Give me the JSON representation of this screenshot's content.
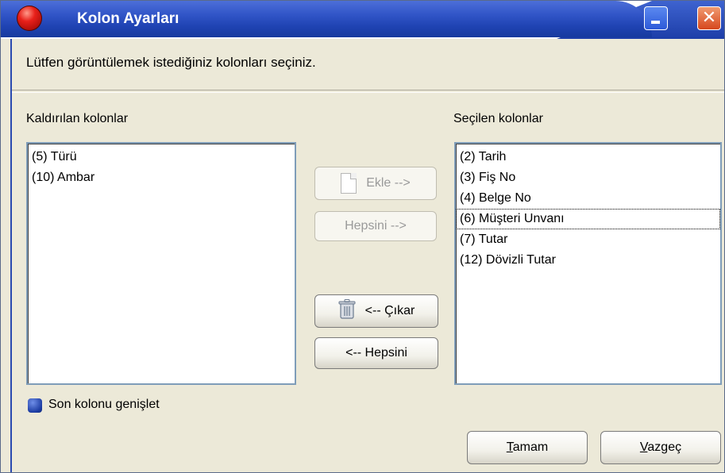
{
  "window": {
    "title": "Kolon Ayarları"
  },
  "instruction": "Lütfen görüntülemek istediğiniz kolonları seçiniz.",
  "left_panel": {
    "label": "Kaldırılan kolonlar",
    "items": [
      "(5) Türü",
      "(10) Ambar"
    ]
  },
  "right_panel": {
    "label": "Seçilen kolonlar",
    "items": [
      "(2) Tarih",
      "(3) Fiş No",
      "(4) Belge No",
      "(6) Müşteri Unvanı",
      "(7) Tutar",
      "(12) Dövizli Tutar"
    ],
    "focused_item": "(6) Müşteri Unvanı"
  },
  "buttons": {
    "add": "Ekle -->",
    "add_all": "Hepsini -->",
    "remove": "<-- Çıkar",
    "remove_all": "<-- Hepsini",
    "ok_first": "T",
    "ok_rest": "amam",
    "cancel_first": "V",
    "cancel_rest": "azgeç"
  },
  "expand_last_column": {
    "label": "Son kolonu genişlet"
  },
  "colors": {
    "titlebar": "#1f43b3",
    "dialog_bg": "#ece9d8",
    "list_border": "#7f9db9"
  },
  "icons": {
    "app": "red-orb-icon",
    "minimize": "minimize-icon",
    "close": "close-icon",
    "add": "document-icon",
    "remove": "trash-icon"
  }
}
